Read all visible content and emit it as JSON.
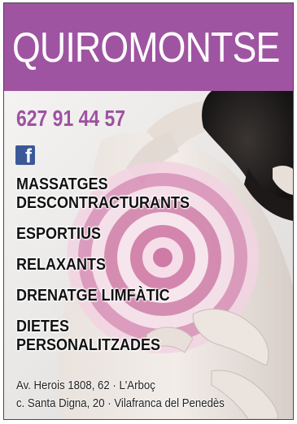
{
  "brand": "QUIROMONTSE",
  "phone": "627 91 44 57",
  "social": {
    "icon": "facebook-icon",
    "glyph": "f",
    "color": "#3b5998"
  },
  "services": [
    {
      "line1": "MASSATGES",
      "line2": "DESCONTRACTURANTS"
    },
    {
      "line1": "ESPORTIUS",
      "line2": ""
    },
    {
      "line1": "RELAXANTS",
      "line2": ""
    },
    {
      "line1": "DRENATGE LIMFÀTIC",
      "line2": ""
    },
    {
      "line1": "DIETES",
      "line2": "PERSONALITZADES"
    }
  ],
  "addresses": [
    "Av. Herois 1808, 62 · L'Arboç",
    "c. Santa Digna, 20 · Vilafranca del Penedès"
  ],
  "colors": {
    "brand_purple": "#9f54a2",
    "phone_purple": "#9e52a1",
    "text": "#111111",
    "target_pink": "#d98fb8"
  }
}
